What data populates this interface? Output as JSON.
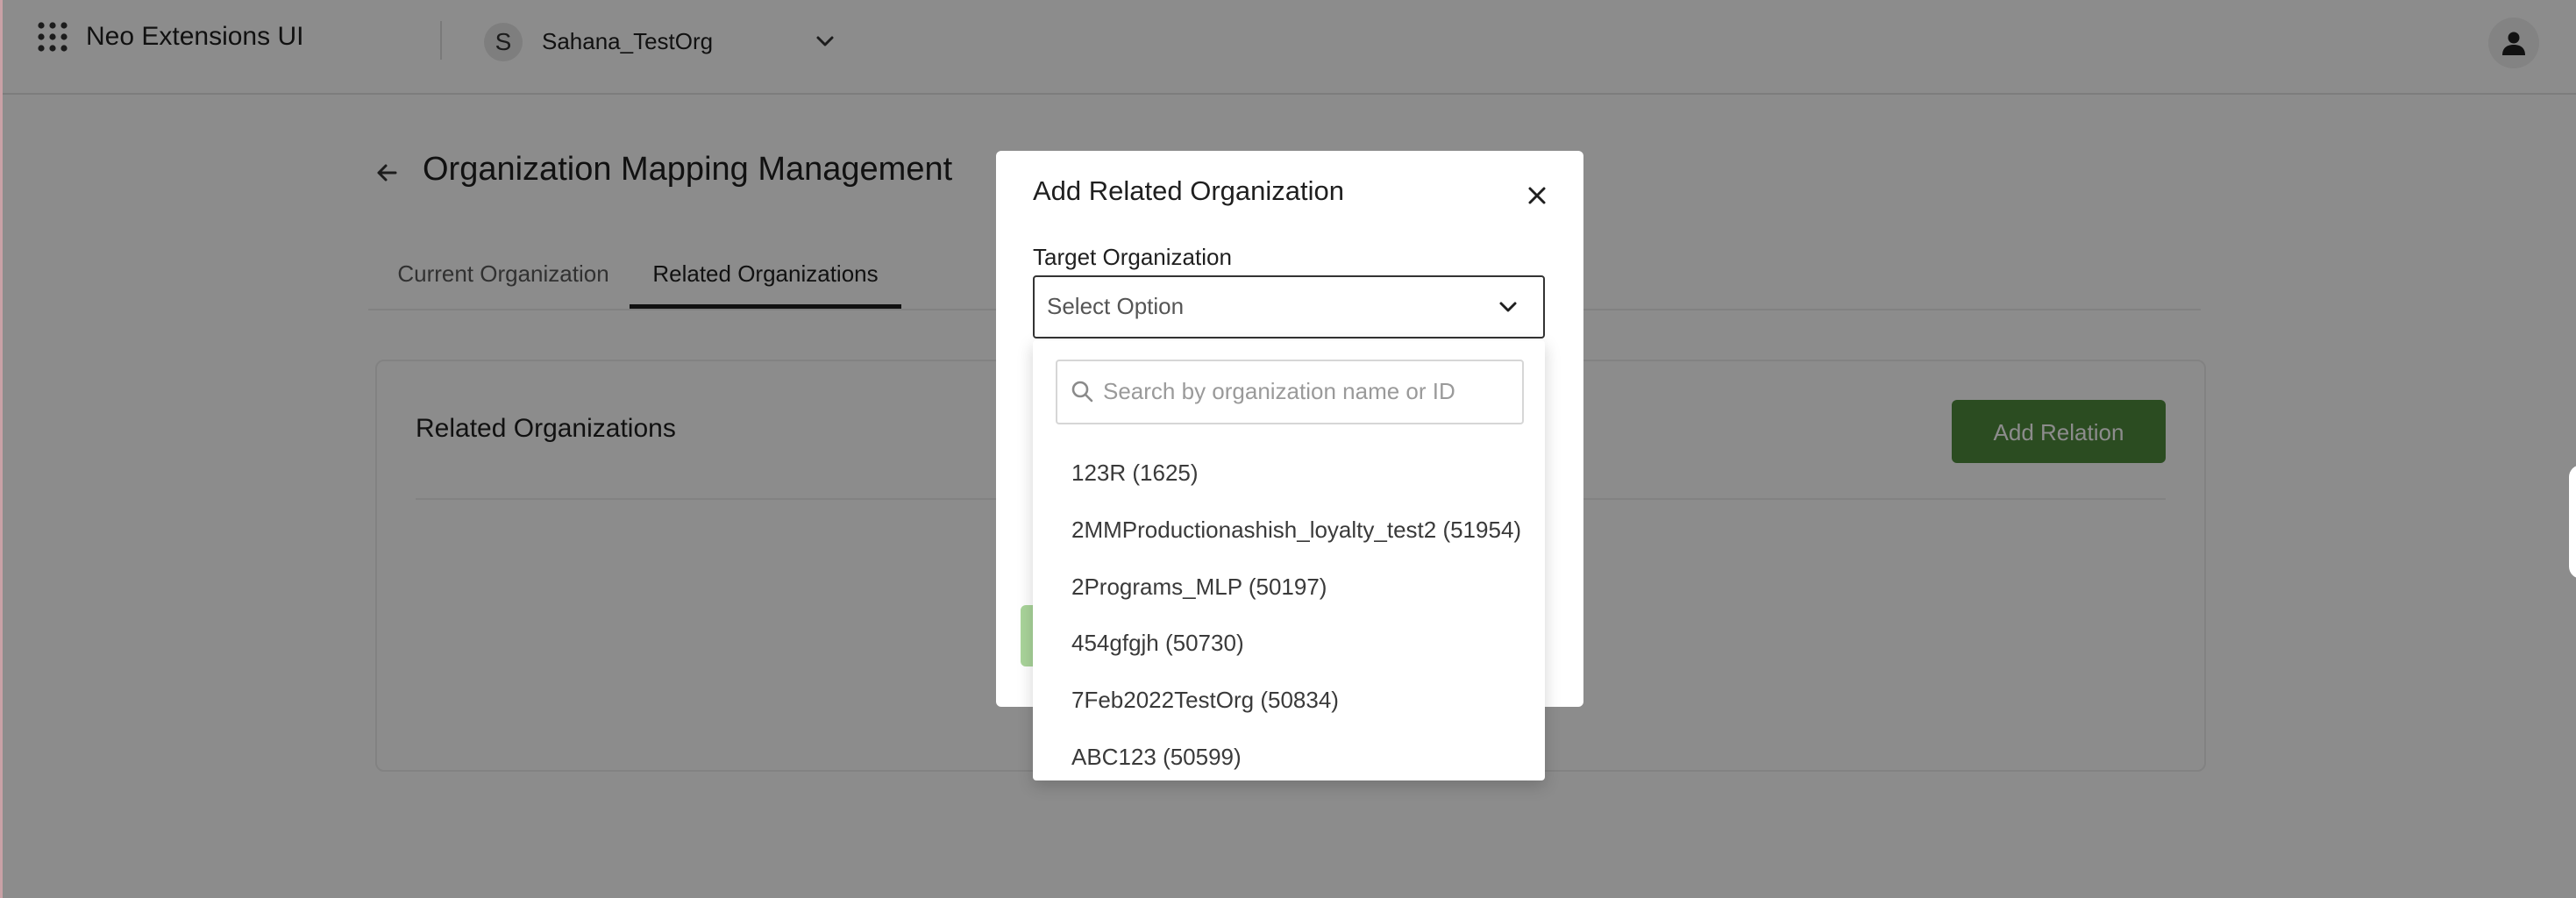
{
  "header": {
    "app_title": "Neo Extensions UI",
    "apps_icon": "grid-dots-icon",
    "org_initial": "S",
    "org_name": "Sahana_TestOrg",
    "org_chevron_icon": "chevron-down-icon",
    "user_icon": "person-icon"
  },
  "page": {
    "back_icon": "arrow-left-icon",
    "title": "Organization Mapping Management",
    "tabs": [
      {
        "label": "Current Organization",
        "active": false
      },
      {
        "label": "Related Organizations",
        "active": true
      }
    ]
  },
  "card": {
    "title": "Related Organizations",
    "add_button_label": "Add Relation"
  },
  "modal": {
    "title": "Add Related Organization",
    "close_icon": "close-icon",
    "field_label": "Target Organization",
    "select_value": "Select Option",
    "select_chevron_icon": "chevron-down-icon"
  },
  "dropdown": {
    "search_placeholder": "Search by organization name or ID",
    "search_value": "",
    "options": [
      "123R (1625)",
      "2MMProductionashish_loyalty_test2 (51954)",
      "2Programs_MLP (50197)",
      "454gfgjh (50730)",
      "7Feb2022TestOrg (50834)",
      "ABC123 (50599)"
    ]
  },
  "colors": {
    "primary_button": "#4f8a3c",
    "overlay": "rgba(0,0,0,0.45)"
  }
}
